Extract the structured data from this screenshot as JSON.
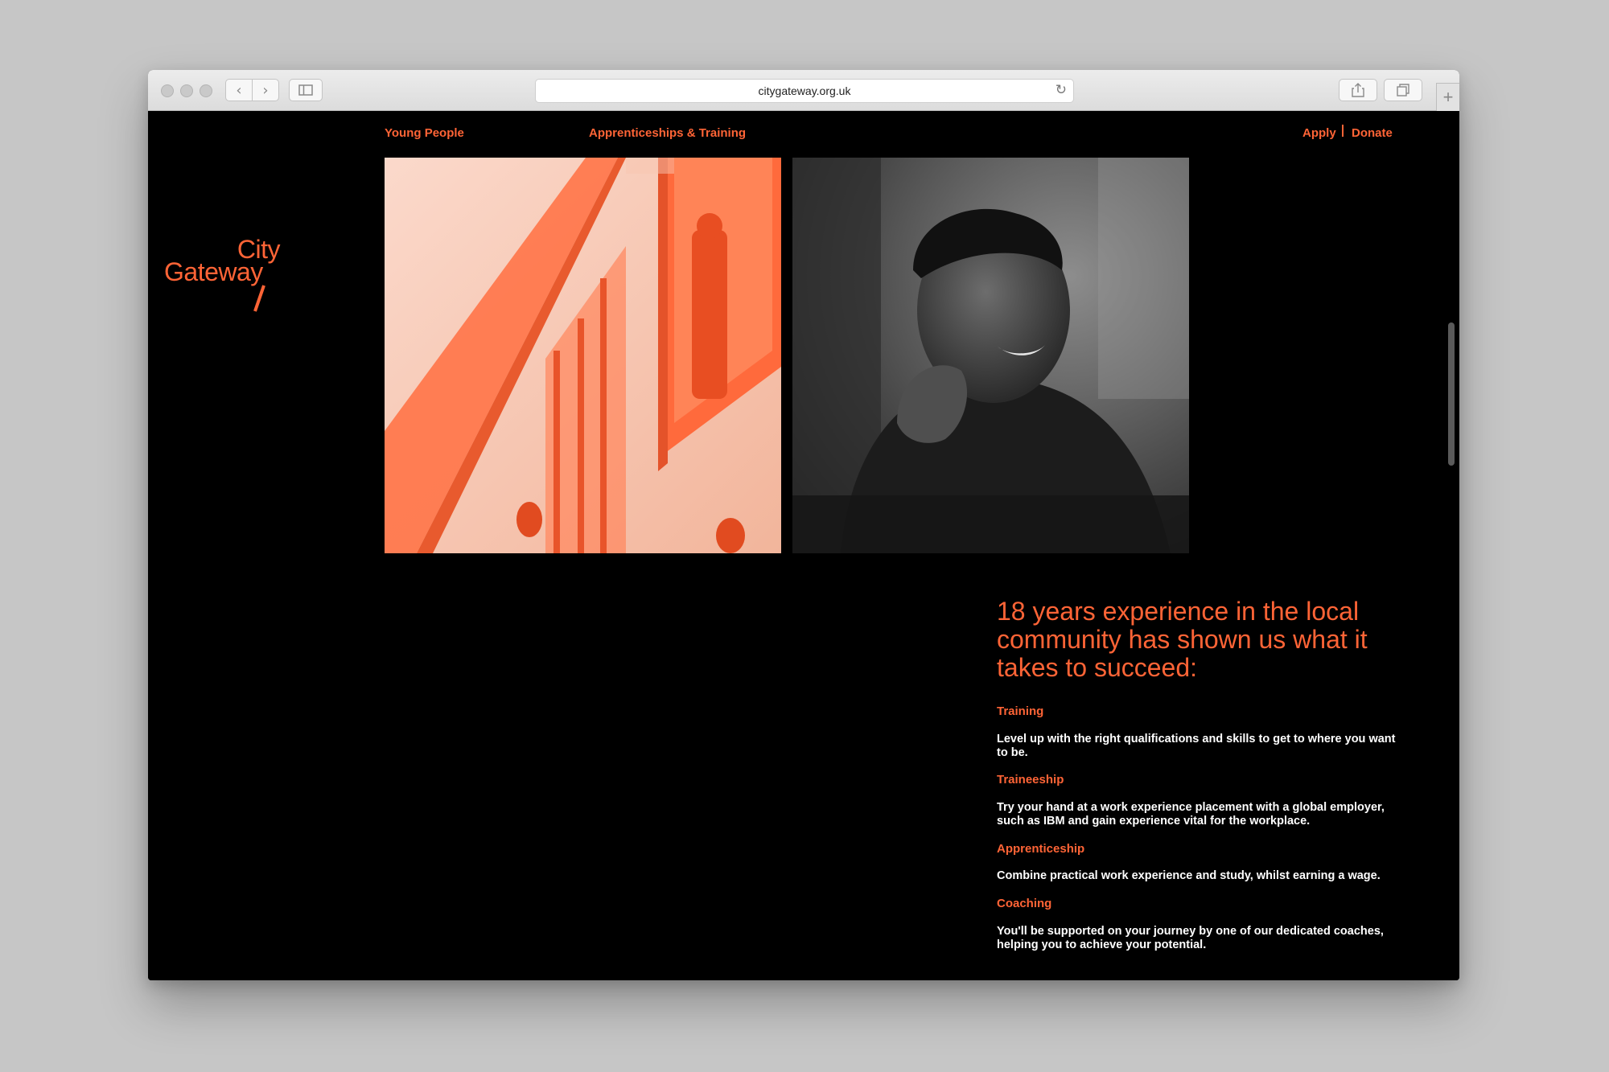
{
  "browser": {
    "url": "citygateway.org.uk"
  },
  "nav": {
    "young_people": "Young People",
    "apprenticeships": "Apprenticeships & Training",
    "apply": "Apply",
    "donate": "Donate"
  },
  "logo": {
    "line1": "City",
    "line2": "Gateway"
  },
  "headline": "18 years experience in the local community has shown us what it takes to succeed:",
  "services": [
    {
      "title": "Training",
      "desc": "Level up with the right qualifications and skills to get to where you want to be."
    },
    {
      "title": "Traineeship",
      "desc": "Try your hand at a work experience placement with a global employer, such as IBM and gain experience vital for the workplace."
    },
    {
      "title": "Apprenticeship",
      "desc": "Combine practical work experience and study, whilst earning a wage."
    },
    {
      "title": "Coaching",
      "desc": "You'll be supported on your journey by one of our dedicated coaches, helping you to achieve your potential."
    }
  ],
  "colors": {
    "brand": "#ff6436",
    "page_bg": "#000000",
    "desktop_bg": "#c6c6c6"
  }
}
